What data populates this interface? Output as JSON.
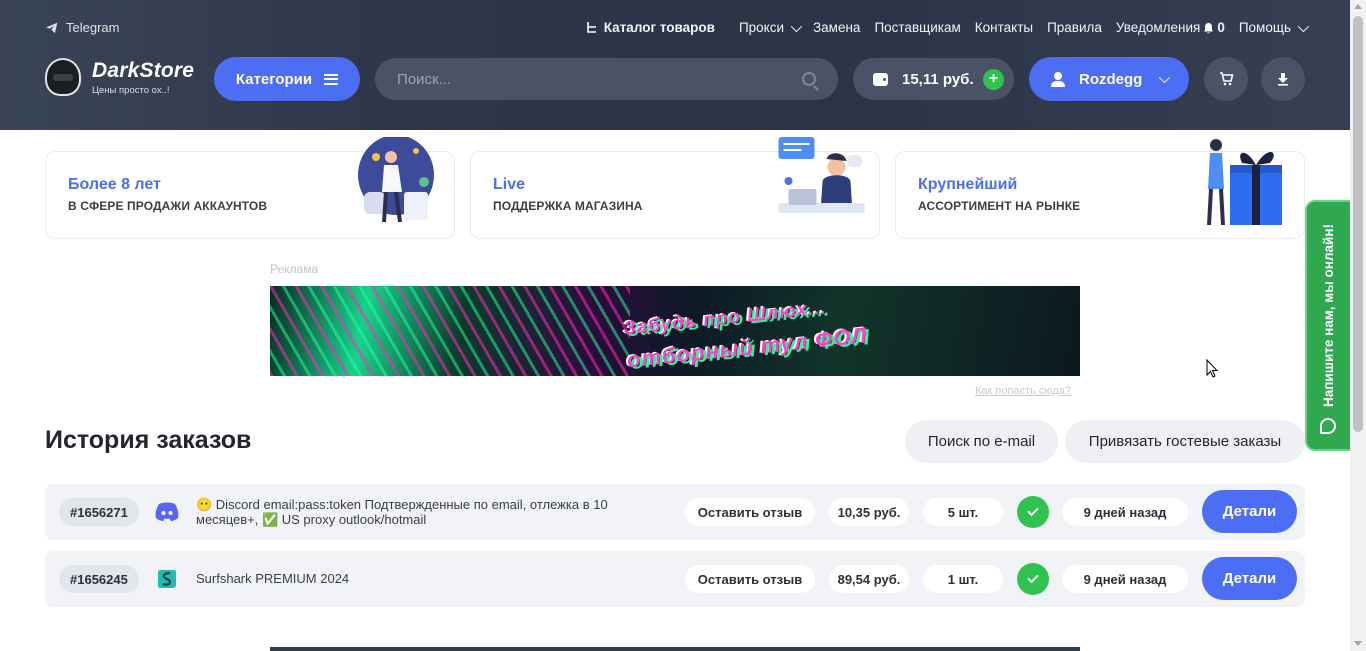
{
  "header": {
    "telegram_label": "Telegram",
    "nav": {
      "catalog": "Каталог товаров",
      "proxy": "Прокси",
      "replace": "Замена",
      "suppliers": "Поставщикам",
      "contacts": "Контакты",
      "rules": "Правила",
      "notifications": "Уведомления",
      "notifications_count": "0",
      "help": "Помощь"
    },
    "logo_title": "DarkStore",
    "logo_subtitle": "Цены просто ох..!",
    "categories_label": "Категории",
    "search_placeholder": "Поиск...",
    "balance": "15,11 руб.",
    "username": "Rozdegg"
  },
  "features": [
    {
      "title": "Более 8 лет",
      "subtitle": "В СФЕРЕ ПРОДАЖИ АККАУНТОВ"
    },
    {
      "title": "Live",
      "subtitle": "ПОДДЕРЖКА МАГАЗИНА"
    },
    {
      "title": "Крупнейший",
      "subtitle": "АССОРТИМЕНТ НА РЫНКЕ"
    }
  ],
  "ad": {
    "label": "Реклама",
    "banner_line1": "Забудь про Шлюх...",
    "banner_line2": "отборный тул ФОЛ",
    "how_to_link": "Как попасть сюда?"
  },
  "orders": {
    "title": "История заказов",
    "search_email_label": "Поиск по e-mail",
    "bind_guest_label": "Привязать гостевые заказы",
    "rows": [
      {
        "id": "#1656271",
        "product": "😶 Discord email:pass:token Подтвержденные по email, отлежка в 10 месяцев+, ✅ US proxy outlook/hotmail",
        "review_label": "Оставить отзыв",
        "price": "10,35 руб.",
        "qty": "5 шт.",
        "date": "9 дней назад",
        "details_label": "Детали",
        "icon": "discord-icon",
        "icon_color": "#5865f2"
      },
      {
        "id": "#1656245",
        "product": "Surfshark PREMIUM 2024",
        "review_label": "Оставить отзыв",
        "price": "89,54 руб.",
        "qty": "1 шт.",
        "date": "9 дней назад",
        "details_label": "Детали",
        "icon": "surfshark-icon",
        "icon_color": "#1cbdb4"
      }
    ]
  },
  "chat_tab_label": "Напишите нам, мы онлайн!",
  "colors": {
    "accent": "#4c6ef5",
    "success": "#2fc24f",
    "header_bg": "#2e3749"
  }
}
